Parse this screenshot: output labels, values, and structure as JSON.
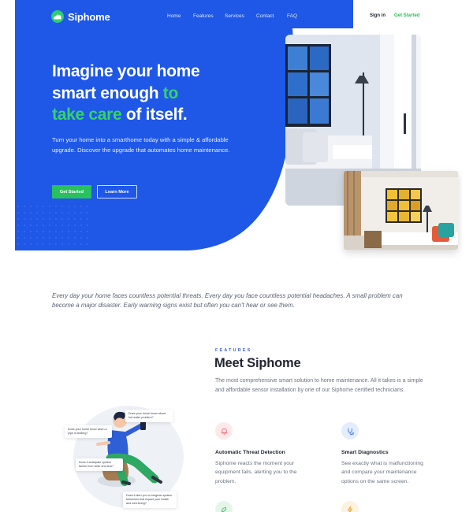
{
  "brand": {
    "name": "Siphome",
    "blue": "#1f57e7",
    "green": "#28c15e"
  },
  "nav": {
    "links": [
      "Home",
      "Features",
      "Services",
      "Contact",
      "FAQ"
    ],
    "sign_in": "Sign in",
    "get_started": "Get Started"
  },
  "hero": {
    "title_line1": "Imagine your home",
    "title_line2a": "smart enough ",
    "title_line2b": "to",
    "title_line3a": "take care",
    "title_line3b": " of itself.",
    "subtitle": "Turn your home into a smarthome today with a simple & affordable upgrade. Discover the upgrade that automates home maintenance.",
    "primary_button": "Get Started",
    "secondary_button": "Learn More"
  },
  "intro_quote": "Every day your home faces countless potential threats. Every day you face countless potential headaches. A small problem can become a major disaster. Early warning signs exist but often you can't hear or see them.",
  "features": {
    "eyebrow": "FEATURES",
    "title": "Meet Siphome",
    "description": "The most comprehensive smart solution to home maintenance. All it takes is a simple and affordable sensor installation by one of our Siphome certified technicians.",
    "items": [
      {
        "title": "Automatic Threat Detection",
        "text": "Siphome reacts the moment your equipment fails, alerting you to the problem.",
        "icon": "alarm-bell-icon",
        "icon_color": "#f06a7a",
        "icon_bg": "#fde8ea"
      },
      {
        "title": "Smart Diagnostics",
        "text": "See exactly what is malfunctioning and compare your maintenance options on the same screen.",
        "icon": "stethoscope-icon",
        "icon_color": "#4a7ae8",
        "icon_bg": "#e4edfd"
      }
    ],
    "extra_icons": [
      {
        "icon": "leaf-icon",
        "icon_color": "#3cb46a",
        "icon_bg": "#e4f6ea"
      },
      {
        "icon": "bolt-icon",
        "icon_color": "#e8a23c",
        "icon_bg": "#fdf1df"
      }
    ]
  },
  "illustration_bubbles": [
    "Does your home know about hot water problem?",
    "Does your home know when a pipe is leaking?",
    "Does it anticipate system failure from wear and tear?",
    "Does it alert you to irregular system behaviors that impact your health and well-being?"
  ]
}
